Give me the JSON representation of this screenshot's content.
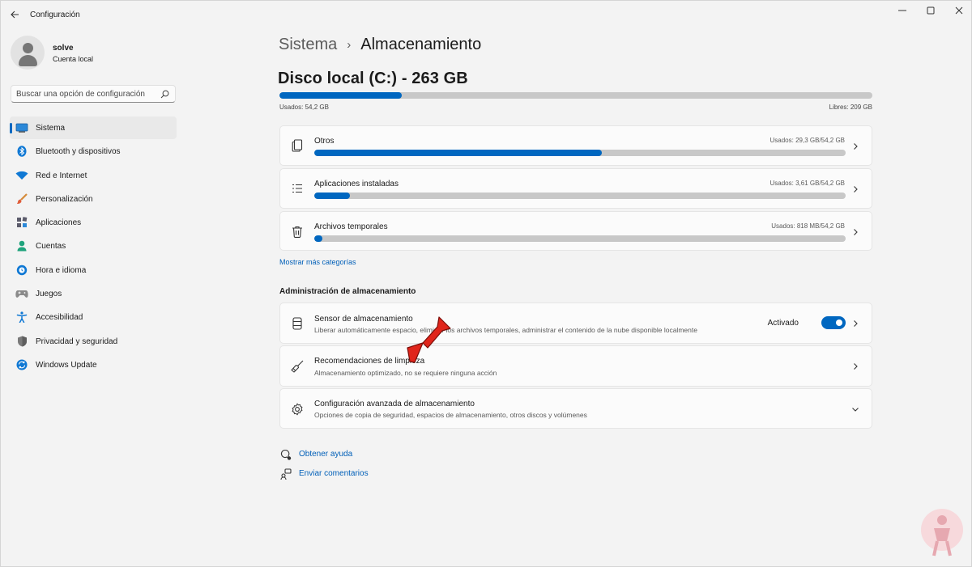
{
  "window": {
    "title": "Configuración"
  },
  "profile": {
    "name": "solve",
    "account_type": "Cuenta local"
  },
  "search": {
    "placeholder": "Buscar una opción de configuración"
  },
  "sidebar": {
    "items": [
      {
        "label": "Sistema",
        "icon": "system-icon",
        "active": true
      },
      {
        "label": "Bluetooth y dispositivos",
        "icon": "bluetooth-icon"
      },
      {
        "label": "Red e Internet",
        "icon": "wifi-icon"
      },
      {
        "label": "Personalización",
        "icon": "brush-icon"
      },
      {
        "label": "Aplicaciones",
        "icon": "apps-icon"
      },
      {
        "label": "Cuentas",
        "icon": "accounts-icon"
      },
      {
        "label": "Hora e idioma",
        "icon": "time-language-icon"
      },
      {
        "label": "Juegos",
        "icon": "gamepad-icon"
      },
      {
        "label": "Accesibilidad",
        "icon": "accessibility-icon"
      },
      {
        "label": "Privacidad y seguridad",
        "icon": "shield-icon"
      },
      {
        "label": "Windows Update",
        "icon": "windows-update-icon"
      }
    ]
  },
  "breadcrumb": {
    "parent": "Sistema",
    "separator": "›",
    "current": "Almacenamiento"
  },
  "disk": {
    "title": "Disco local (C:) - 263 GB",
    "used_label": "Usados: 54,2 GB",
    "free_label": "Libres: 209 GB",
    "used_fraction": 0.206
  },
  "categories": [
    {
      "label": "Otros",
      "usage": "Usados: 29,3 GB/54,2 GB",
      "fraction": 0.541,
      "icon": "other-files-icon"
    },
    {
      "label": "Aplicaciones instaladas",
      "usage": "Usados: 3,61 GB/54,2 GB",
      "fraction": 0.067,
      "icon": "installed-apps-icon"
    },
    {
      "label": "Archivos temporales",
      "usage": "Usados: 818 MB/54,2 GB",
      "fraction": 0.015,
      "icon": "trash-icon"
    }
  ],
  "more_categories_link": "Mostrar más categorías",
  "management": {
    "section_title": "Administración de almacenamiento",
    "sensor": {
      "title": "Sensor de almacenamiento",
      "description": "Liberar automáticamente espacio, eliminar los archivos temporales, administrar el contenido de la nube disponible localmente",
      "toggle_label": "Activado",
      "toggle_on": true,
      "icon": "storage-drive-icon"
    },
    "cleanup": {
      "title": "Recomendaciones de limpieza",
      "description": "Almacenamiento optimizado, no se requiere ninguna acción",
      "icon": "broom-icon"
    },
    "advanced": {
      "title": "Configuración avanzada de almacenamiento",
      "description": "Opciones de copia de seguridad, espacios de almacenamiento, otros discos y volúmenes",
      "icon": "gear-icon"
    }
  },
  "help": {
    "get_help": "Obtener ayuda",
    "feedback": "Enviar comentarios"
  },
  "colors": {
    "accent": "#0067c0",
    "link": "#005fb8",
    "bar_track": "#c8c8c8",
    "annotation_arrow": "#e0251b"
  }
}
